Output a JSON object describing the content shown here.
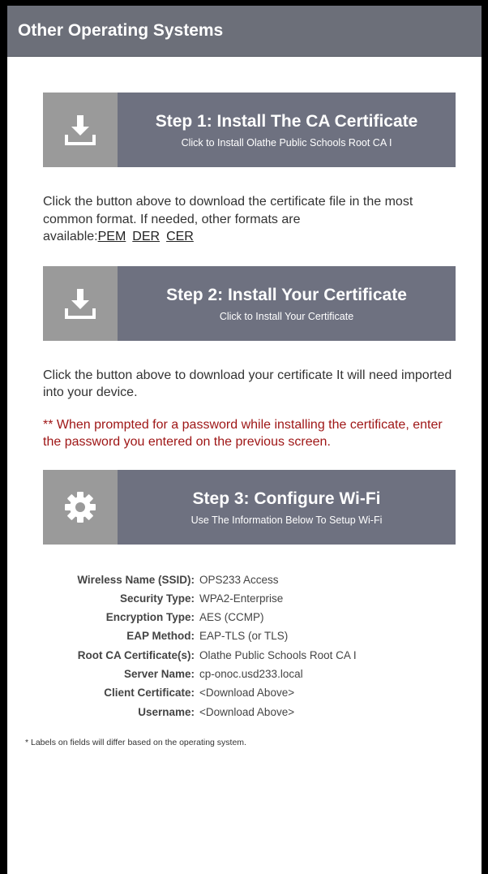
{
  "header": {
    "title": "Other Operating Systems"
  },
  "steps": [
    {
      "title": "Step 1: Install The CA Certificate",
      "subtitle": "Click to Install Olathe Public Schools Root CA I",
      "icon": "download-icon"
    },
    {
      "title": "Step 2: Install Your Certificate",
      "subtitle": "Click to Install Your Certificate",
      "icon": "download-icon"
    },
    {
      "title": "Step 3: Configure Wi-Fi",
      "subtitle": "Use The Information Below To Setup Wi-Fi",
      "icon": "gear-icon"
    }
  ],
  "step1_text": {
    "body": "Click the button above to download the certificate file in the most common format. If needed, other formats are available:",
    "formats": [
      "PEM",
      "DER",
      "CER"
    ]
  },
  "step2_text": "Click the button above to download your certificate It will need imported into your device.",
  "warning": "** When prompted for a password while installing the certificate, enter the password you entered on the previous screen.",
  "params": [
    {
      "label": "Wireless Name (SSID):",
      "value": "OPS233 Access"
    },
    {
      "label": "Security Type:",
      "value": "WPA2-Enterprise"
    },
    {
      "label": "Encryption Type:",
      "value": "AES (CCMP)"
    },
    {
      "label": "EAP Method:",
      "value": "EAP-TLS (or TLS)"
    },
    {
      "label": "Root CA Certificate(s):",
      "value": "Olathe Public Schools Root CA I"
    },
    {
      "label": "Server Name:",
      "value": "cp-onoc.usd233.local"
    },
    {
      "label": "Client Certificate:",
      "value": "<Download Above>"
    },
    {
      "label": "Username:",
      "value": "<Download Above>"
    }
  ],
  "footnote": "* Labels on fields will differ based on the operating system.",
  "colors": {
    "header_bg": "#6c6f79",
    "step_bg": "#6e7180",
    "icon_bg": "#9a9a9a",
    "warning": "#9e1515"
  }
}
